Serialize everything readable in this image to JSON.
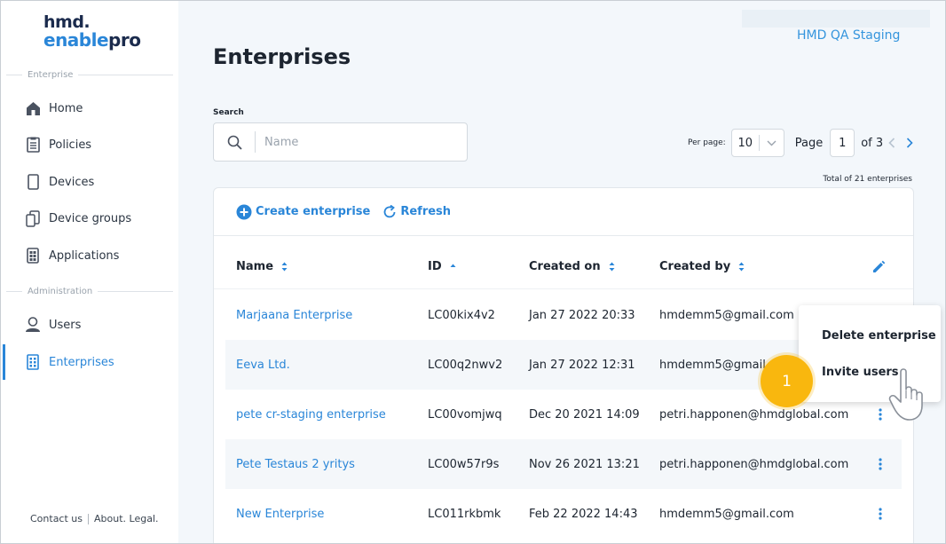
{
  "brand": {
    "line1": "hmd.",
    "line2a": "enable",
    "line2b": "pro"
  },
  "sidebar": {
    "section_enterprise": "Enterprise",
    "section_administration": "Administration",
    "items": [
      {
        "label": "Home",
        "icon": "home-icon"
      },
      {
        "label": "Policies",
        "icon": "policies-icon"
      },
      {
        "label": "Devices",
        "icon": "device-icon"
      },
      {
        "label": "Device groups",
        "icon": "device-groups-icon"
      },
      {
        "label": "Applications",
        "icon": "applications-icon"
      },
      {
        "label": "Users",
        "icon": "user-icon"
      },
      {
        "label": "Enterprises",
        "icon": "building-icon",
        "active": true
      }
    ],
    "footer": {
      "contact": "Contact us",
      "about": "About. Legal."
    }
  },
  "header": {
    "environment": "HMD QA Staging",
    "title": "Enterprises"
  },
  "search": {
    "label": "Search",
    "placeholder": "Name",
    "value": ""
  },
  "pagination": {
    "per_page_label": "Per page:",
    "per_page_value": "10",
    "page_label": "Page",
    "page_value": "1",
    "of_label": "of 3",
    "total": "Total of 21 enterprises"
  },
  "toolbar": {
    "create_label": "Create enterprise",
    "refresh_label": "Refresh"
  },
  "table": {
    "columns": [
      "Name",
      "ID",
      "Created on",
      "Created by"
    ],
    "rows": [
      {
        "name": "Marjaana Enterprise",
        "id": "LC00kix4v2",
        "created_on": "Jan 27 2022 20:33",
        "created_by": "hmdemm5@gmail.com"
      },
      {
        "name": "Eeva Ltd.",
        "id": "LC00q2nwv2",
        "created_on": "Jan 27 2022 12:31",
        "created_by": "hmdemm5@gmail.com"
      },
      {
        "name": "pete cr-staging enterprise",
        "id": "LC00vomjwq",
        "created_on": "Dec 20 2021 14:09",
        "created_by": "petri.happonen@hmdglobal.com"
      },
      {
        "name": "Pete Testaus 2 yritys",
        "id": "LC00w57r9s",
        "created_on": "Nov 26 2021 13:21",
        "created_by": "petri.happonen@hmdglobal.com"
      },
      {
        "name": "New Enterprise",
        "id": "LC011rkbmk",
        "created_on": "Feb 22 2022 14:43",
        "created_by": "hmdemm5@gmail.com"
      }
    ]
  },
  "context_menu": {
    "items": [
      "Delete enterprise",
      "Invite users"
    ]
  },
  "step_badge": "1",
  "colors": {
    "accent": "#2a86d8",
    "badge": "#f9b70e",
    "background": "#f3f7fb"
  }
}
